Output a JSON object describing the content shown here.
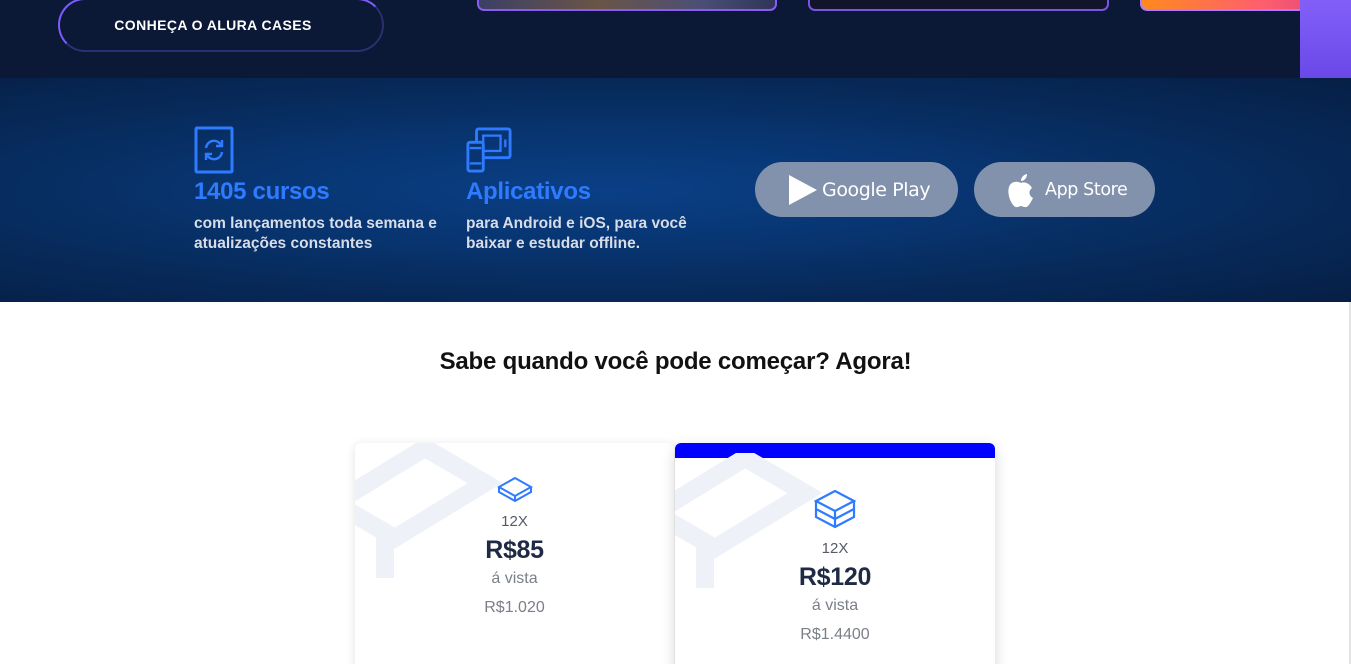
{
  "hero": {
    "cases_button": "CONHEÇA O ALURA CASES"
  },
  "features": [
    {
      "icon": "refresh-icon",
      "title": "1405 cursos",
      "description": "com lançamentos toda semana e atualizações constantes"
    },
    {
      "icon": "devices-icon",
      "title": "Aplicativos",
      "description": "para Android e iOS, para você baixar e estudar offline."
    }
  ],
  "stores": {
    "google_play": "Google Play",
    "app_store": "App Store"
  },
  "pricing": {
    "title": "Sabe quando você pode começar? Agora!",
    "plans": [
      {
        "installments": "12X",
        "price": "R$85",
        "vista_label": "á vista",
        "total": "R$1.020",
        "icon": "layers-icon",
        "highlighted": false
      },
      {
        "installments": "12X",
        "price": "R$120",
        "vista_label": "á vista",
        "total": "R$1.4400",
        "icon": "stacked-layers-icon",
        "highlighted": true
      }
    ]
  },
  "colors": {
    "accent_blue": "#2e7bff",
    "highlight_bar": "#0000ff",
    "store_button": "#8292ac",
    "hero_bg": "#0b1836"
  }
}
